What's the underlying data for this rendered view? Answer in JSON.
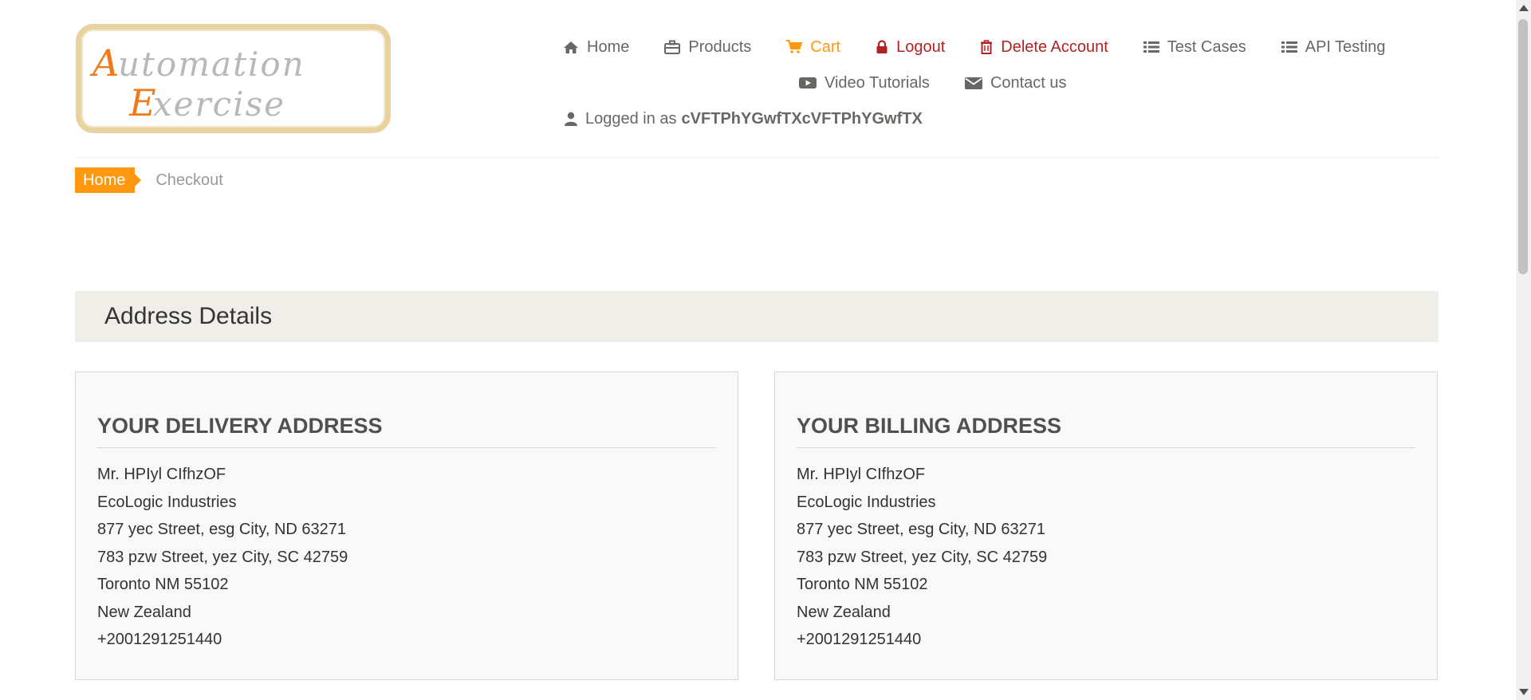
{
  "logo": {
    "line1": "Automation",
    "line2": "Exercise"
  },
  "nav": {
    "home": "Home",
    "products": "Products",
    "cart": "Cart",
    "logout": "Logout",
    "delete_account": "Delete Account",
    "test_cases": "Test Cases",
    "api_testing": "API Testing",
    "video_tutorials": "Video Tutorials",
    "contact_us": "Contact us",
    "logged_in_prefix": "Logged in as",
    "username": "cVFTPhYGwfTXcVFTPhYGwfTX"
  },
  "breadcrumb": {
    "home": "Home",
    "current": "Checkout"
  },
  "section": {
    "title": "Address Details"
  },
  "delivery": {
    "title": "YOUR DELIVERY ADDRESS",
    "lines": [
      "Mr. HPIyl CIfhzOF",
      "EcoLogic Industries",
      "877 yec Street, esg City, ND 63271",
      "783 pzw Street, yez City, SC 42759",
      "Toronto NM 55102",
      "New Zealand",
      "+2001291251440"
    ]
  },
  "billing": {
    "title": "YOUR BILLING ADDRESS",
    "lines": [
      "Mr. HPIyl CIfhzOF",
      "EcoLogic Industries",
      "877 yec Street, esg City, ND 63271",
      "783 pzw Street, yez City, SC 42759",
      "Toronto NM 55102",
      "New Zealand",
      "+2001291251440"
    ]
  },
  "colors": {
    "accent": "#fe980f",
    "danger": "#b22222",
    "nav_text": "#696763",
    "section_bg": "#efeee8"
  },
  "icons": {
    "home": "home-icon",
    "products": "briefcase-icon",
    "cart": "cart-icon",
    "logout": "lock-icon",
    "delete": "trash-icon",
    "test_cases": "list-icon",
    "api_testing": "list-icon",
    "video": "youtube-play-icon",
    "contact": "envelope-icon",
    "user": "user-icon"
  }
}
